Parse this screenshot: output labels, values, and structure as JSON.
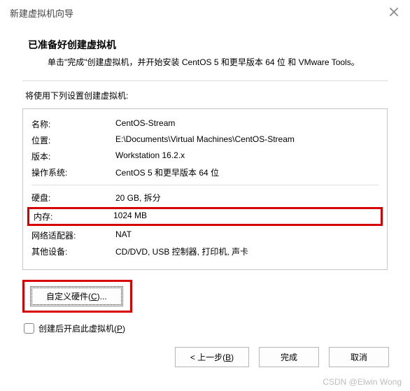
{
  "window": {
    "title": "新建虚拟机向导"
  },
  "header": {
    "heading": "已准备好创建虚拟机",
    "subheading": "单击\"完成\"创建虚拟机，并开始安装 CentOS 5 和更早版本 64 位 和 VMware Tools。"
  },
  "section_label": "将使用下列设置创建虚拟机:",
  "settings": {
    "name_k": "名称:",
    "name_v": "CentOS-Stream",
    "location_k": "位置:",
    "location_v": "E:\\Documents\\Virtual Machines\\CentOS-Stream",
    "version_k": "版本:",
    "version_v": "Workstation 16.2.x",
    "os_k": "操作系统:",
    "os_v": "CentOS 5 和更早版本 64 位",
    "disk_k": "硬盘:",
    "disk_v": "20 GB, 拆分",
    "mem_k": "内存:",
    "mem_v": "1024 MB",
    "net_k": "网络适配器:",
    "net_v": "NAT",
    "other_k": "其他设备:",
    "other_v": "CD/DVD, USB 控制器, 打印机, 声卡"
  },
  "buttons": {
    "customize_pre": "自定义硬件(",
    "customize_key": "C",
    "customize_post": ")...",
    "poweron_pre": "创建后开启此虚拟机(",
    "poweron_key": "P",
    "poweron_post": ")",
    "back_pre": "< 上一步(",
    "back_key": "B",
    "back_post": ")",
    "finish": "完成",
    "cancel": "取消"
  },
  "watermark": "CSDN @Elwin Wong"
}
